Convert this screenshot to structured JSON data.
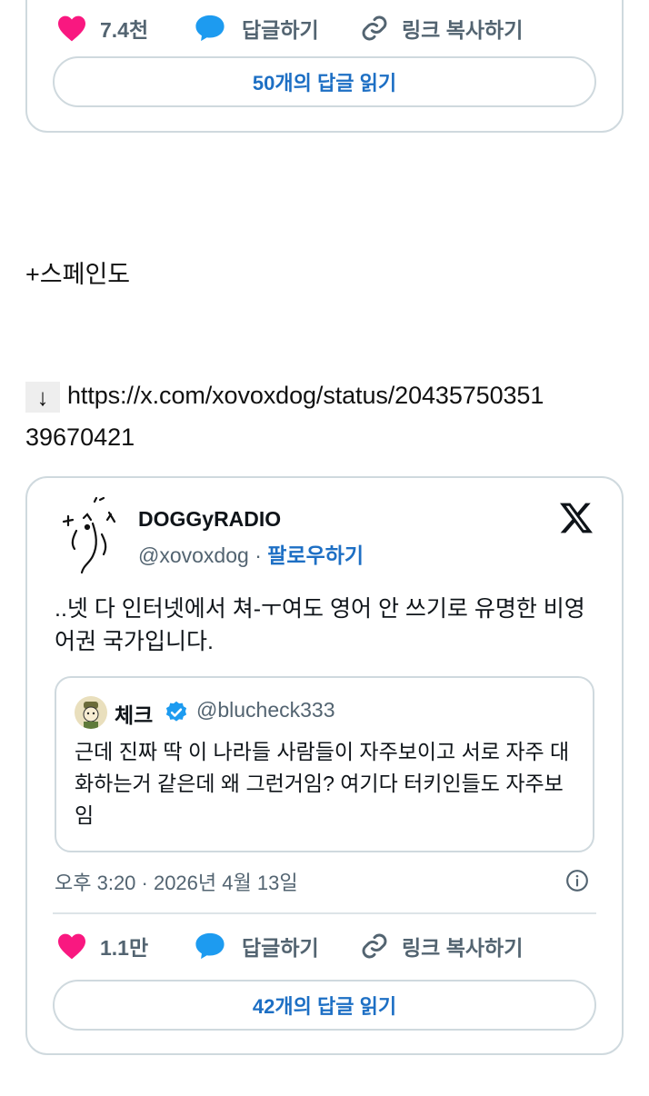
{
  "top_card": {
    "like_count": "7.4천",
    "reply_label": "답글하기",
    "copy_link_label": "링크 복사하기",
    "read_replies_label": "50개의 답글 읽기"
  },
  "plus_spain_text": "+스페인도",
  "link_arrow": "↓",
  "link_url_line1": "https://x.com/xovoxdog/status/20435750351",
  "link_url_line2": "39670421",
  "main_card": {
    "author_name": "DOGGyRADIO",
    "author_handle": "@xovoxdog",
    "separator": "·",
    "follow_label": "팔로우하기",
    "tweet_text": "..넷 다 인터넷에서 쳐-ㅜ여도 영어 안 쓰기로 유명한 비영어권 국가입니다.",
    "quote": {
      "name": "체크",
      "handle": "@blucheck333",
      "text": "근데 진짜 딱 이 나라들 사람들이 자주보이고 서로 자주 대화하는거 같은데 왜 그런거임? 여기다 터키인들도 자주보임"
    },
    "timestamp": "오후 3:20 · 2026년 4월 13일",
    "like_count": "1.1만",
    "reply_label": "답글하기",
    "copy_link_label": "링크 복사하기",
    "read_replies_label": "42개의 답글 읽기"
  },
  "colors": {
    "like_pink": "#f91880",
    "reply_blue": "#1d9bf0",
    "link_blue": "#1d6fc4",
    "border": "#cfd9de",
    "muted_text": "#536471"
  },
  "icons": [
    "heart-icon",
    "speech-bubble-icon",
    "link-icon",
    "x-logo-icon",
    "verified-badge-icon",
    "info-icon"
  ]
}
